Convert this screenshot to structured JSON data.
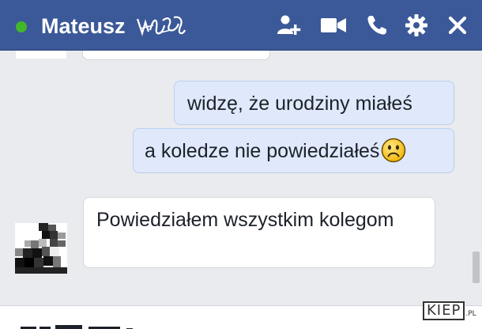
{
  "chat": {
    "contact_name": "Mateusz",
    "status": "online",
    "status_color": "#42b72a",
    "header_color": "#3b5998",
    "header_icons": [
      "add-friend-icon",
      "video-call-icon",
      "phone-icon",
      "gear-icon",
      "close-icon"
    ]
  },
  "messages": [
    {
      "direction": "outgoing",
      "text": "widzę, że urodziny miałeś"
    },
    {
      "direction": "outgoing",
      "text": "a koledze nie powiedziałeś",
      "emoji": "frown-emoji"
    },
    {
      "direction": "incoming",
      "text": "Powiedziałem wszystkim kolegom"
    }
  ],
  "watermark": {
    "text": "KIEP",
    "suffix": ".PL"
  }
}
